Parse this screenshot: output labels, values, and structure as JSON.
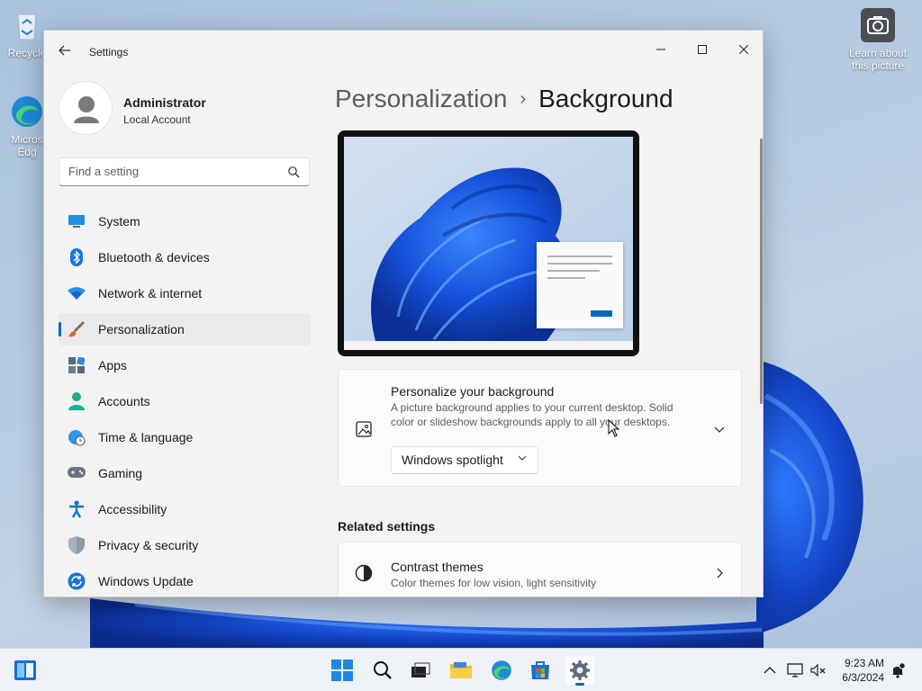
{
  "desktop": {
    "recycle_bin_label": "Recycle",
    "edge_label": "Micros Edg",
    "learn_picture_label": "Learn about this picture"
  },
  "window": {
    "title": "Settings",
    "minimize_icon": "minimize-icon",
    "maximize_icon": "maximize-icon",
    "close_icon": "close-icon"
  },
  "profile": {
    "name": "Administrator",
    "account_type": "Local Account"
  },
  "search": {
    "placeholder": "Find a setting"
  },
  "nav": {
    "items": [
      {
        "label": "System",
        "icon": "system-icon"
      },
      {
        "label": "Bluetooth & devices",
        "icon": "bluetooth-icon"
      },
      {
        "label": "Network & internet",
        "icon": "wifi-icon"
      },
      {
        "label": "Personalization",
        "icon": "brush-icon",
        "active": true
      },
      {
        "label": "Apps",
        "icon": "apps-icon"
      },
      {
        "label": "Accounts",
        "icon": "person-icon"
      },
      {
        "label": "Time & language",
        "icon": "globe-clock-icon"
      },
      {
        "label": "Gaming",
        "icon": "gamepad-icon"
      },
      {
        "label": "Accessibility",
        "icon": "accessibility-icon"
      },
      {
        "label": "Privacy & security",
        "icon": "shield-icon"
      },
      {
        "label": "Windows Update",
        "icon": "update-icon"
      }
    ]
  },
  "breadcrumb": {
    "parent": "Personalization",
    "separator": "›",
    "current": "Background"
  },
  "background_card": {
    "title": "Personalize your background",
    "description": "A picture background applies to your current desktop. Solid color or slideshow backgrounds apply to all your desktops.",
    "select_value": "Windows spotlight"
  },
  "related": {
    "heading": "Related settings",
    "contrast_title": "Contrast themes",
    "contrast_desc": "Color themes for low vision, light sensitivity"
  },
  "taskbar": {
    "time": "9:23 AM",
    "date": "6/3/2024"
  },
  "colors": {
    "accent": "#0067c0",
    "bloom_blue": "#1a56d6"
  }
}
